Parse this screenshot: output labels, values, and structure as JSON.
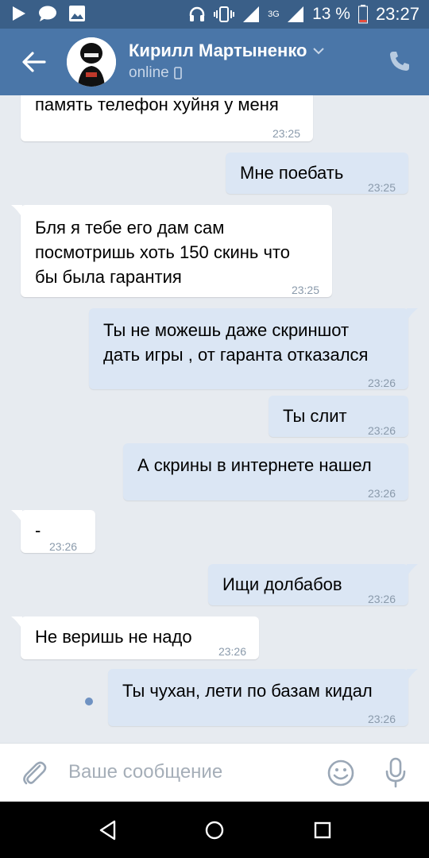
{
  "status_bar": {
    "battery": "13 %",
    "time": "23:27",
    "network": "3G"
  },
  "header": {
    "name": "Кирилл Мартыненко",
    "status": "online"
  },
  "messages": [
    {
      "dir": "in",
      "text": "память телефон хуйня у меня",
      "time": "23:25"
    },
    {
      "dir": "out",
      "text": "Мне поебать",
      "time": "23:25"
    },
    {
      "dir": "in",
      "lines": [
        "Бля я тебе его дам сам",
        "посмотришь хоть 150 скинь что",
        "бы была гарантия"
      ],
      "time": "23:25"
    },
    {
      "dir": "out",
      "lines": [
        "Ты не можешь даже скриншот",
        "дать игры , от гаранта отказался"
      ],
      "time": "23:26"
    },
    {
      "dir": "out",
      "text": "Ты слит",
      "time": "23:26"
    },
    {
      "dir": "out",
      "text": "А скрины в интернете нашел",
      "time": "23:26"
    },
    {
      "dir": "in",
      "text": "-",
      "time": "23:26"
    },
    {
      "dir": "out",
      "text": "Ищи долбабов",
      "time": "23:26"
    },
    {
      "dir": "in",
      "text": "Не веришь не надо",
      "time": "23:26"
    },
    {
      "dir": "out",
      "text": "Ты чухан, лети по базам кидал",
      "time": "23:26"
    }
  ],
  "composer": {
    "placeholder": "Ваше сообщение"
  },
  "colors": {
    "header": "#4a76a8",
    "status_bar": "#3a5f88",
    "background": "#e7ebf0",
    "outgoing_bubble": "#dbe6f4",
    "incoming_bubble": "#ffffff"
  },
  "icons": [
    "play-icon",
    "chat-icon",
    "image-icon",
    "headphones-icon",
    "vibrate-icon",
    "signal-icon",
    "battery-icon",
    "back-arrow-icon",
    "chevron-down-icon",
    "phone-status-icon",
    "call-icon",
    "attach-icon",
    "emoji-icon",
    "mic-icon",
    "nav-back-icon",
    "nav-home-icon",
    "nav-recents-icon"
  ]
}
